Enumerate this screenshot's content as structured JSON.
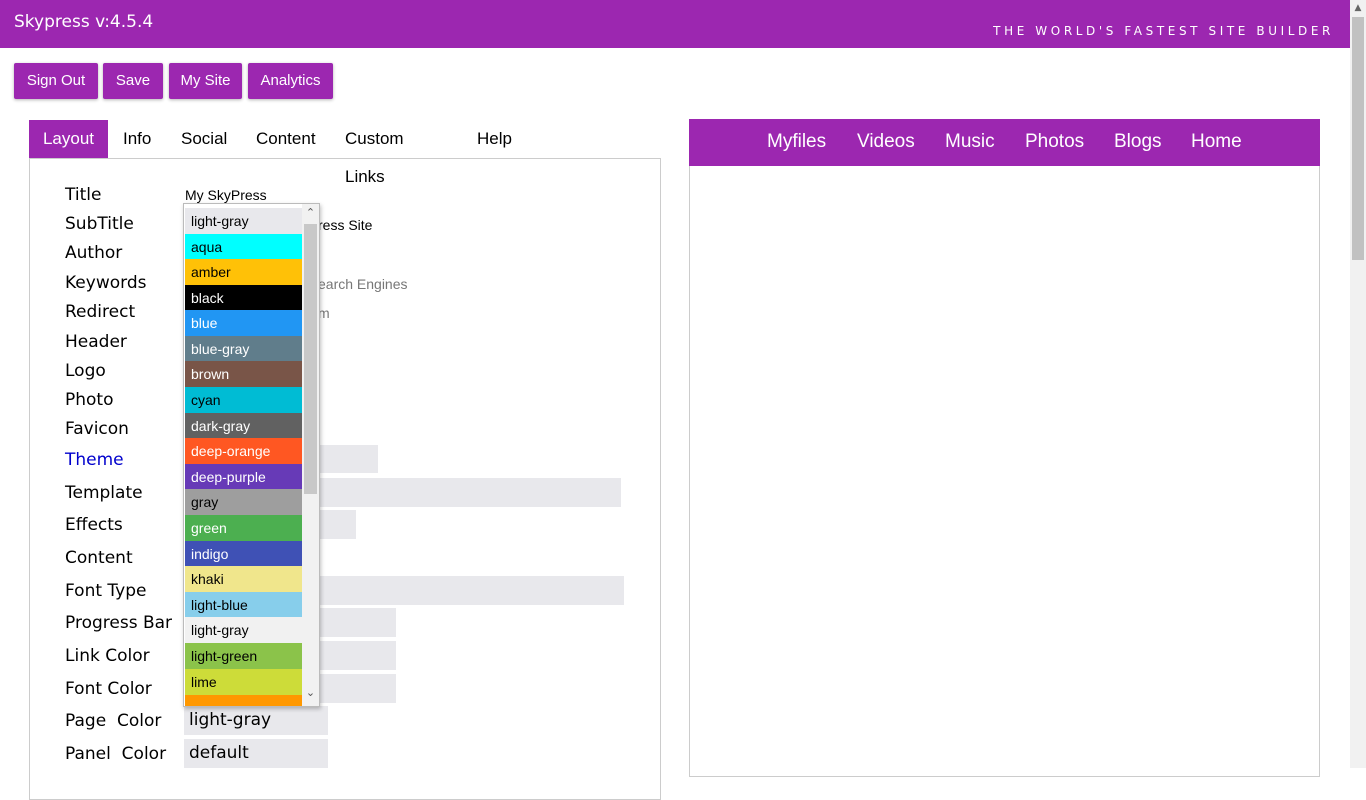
{
  "header": {
    "title": "Skypress v:4.5.4",
    "tagline": "THE WORLD'S FASTEST SITE BUILDER",
    "color": "#9c27b0"
  },
  "toolbar": [
    "Sign Out",
    "Save",
    "My Site",
    "Analytics"
  ],
  "tabs": [
    "Layout",
    "Info",
    "Social",
    "Content",
    "Custom Links",
    "Help"
  ],
  "form": {
    "labels": [
      "Title",
      "SubTitle",
      "Author",
      "Keywords",
      "Redirect",
      "Header",
      "Logo",
      "Photo",
      "Favicon",
      "Theme",
      "Template",
      "Effects",
      "Content",
      "Font Type",
      "Progress Bar",
      "Link Color",
      "Font Color",
      "Page  Color",
      "Panel  Color"
    ],
    "title_value": "My SkyPress",
    "subtitle_partial": "ress Site",
    "keywords_partial": "earch Engines",
    "redirect_partial": "m",
    "page_color": "light-gray",
    "panel_color": "default"
  },
  "dropdown": {
    "selected": "light-gray",
    "options": [
      {
        "label": "light-gray",
        "bg": "#e8e8ec",
        "fg": "#000000"
      },
      {
        "label": "aqua",
        "bg": "#00ffff",
        "fg": "#000000"
      },
      {
        "label": "amber",
        "bg": "#ffc107",
        "fg": "#000000"
      },
      {
        "label": "black",
        "bg": "#000000",
        "fg": "#ffffff"
      },
      {
        "label": "blue",
        "bg": "#2196f3",
        "fg": "#ffffff"
      },
      {
        "label": "blue-gray",
        "bg": "#607d8b",
        "fg": "#ffffff"
      },
      {
        "label": "brown",
        "bg": "#795548",
        "fg": "#ffffff"
      },
      {
        "label": "cyan",
        "bg": "#00bcd4",
        "fg": "#000000"
      },
      {
        "label": "dark-gray",
        "bg": "#616161",
        "fg": "#ffffff"
      },
      {
        "label": "deep-orange",
        "bg": "#ff5722",
        "fg": "#ffffff"
      },
      {
        "label": "deep-purple",
        "bg": "#673ab7",
        "fg": "#ffffff"
      },
      {
        "label": "gray",
        "bg": "#9e9e9e",
        "fg": "#000000"
      },
      {
        "label": "green",
        "bg": "#4caf50",
        "fg": "#ffffff"
      },
      {
        "label": "indigo",
        "bg": "#3f51b5",
        "fg": "#ffffff"
      },
      {
        "label": "khaki",
        "bg": "#f0e68c",
        "fg": "#000000"
      },
      {
        "label": "light-blue",
        "bg": "#87ceeb",
        "fg": "#000000"
      },
      {
        "label": "light-gray",
        "bg": "#f1f1f1",
        "fg": "#000000"
      },
      {
        "label": "light-green",
        "bg": "#8bc34a",
        "fg": "#000000"
      },
      {
        "label": "lime",
        "bg": "#cddc39",
        "fg": "#000000"
      }
    ]
  },
  "preview_nav": [
    "Myfiles",
    "Videos",
    "Music",
    "Photos",
    "Blogs",
    "Home"
  ]
}
